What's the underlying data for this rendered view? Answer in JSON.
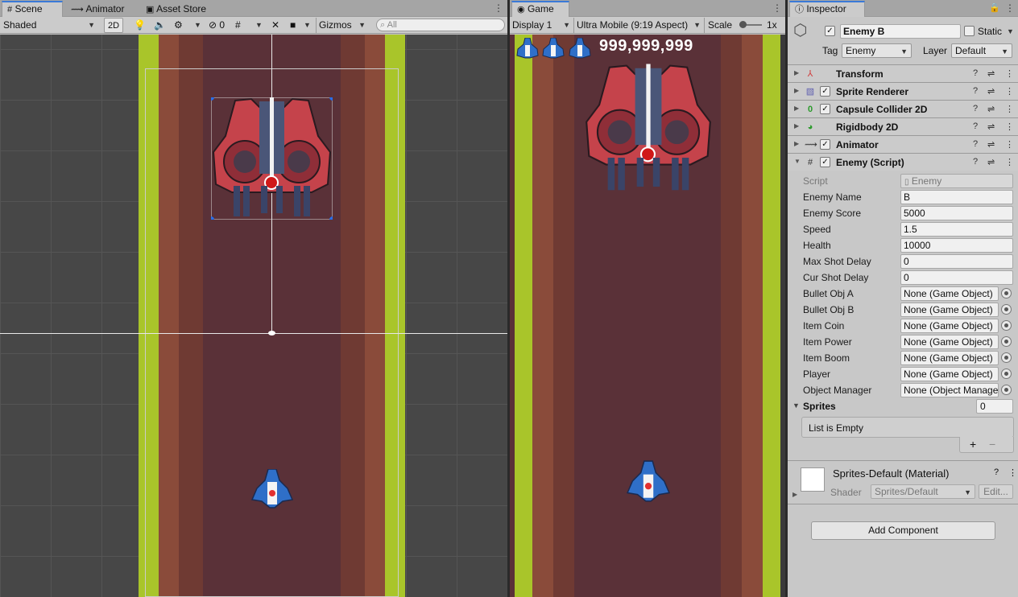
{
  "scene": {
    "tabs": [
      {
        "label": "Scene",
        "icon": "grid-icon"
      },
      {
        "label": "Animator",
        "icon": "animator-icon"
      },
      {
        "label": "Asset Store",
        "icon": "store-icon"
      }
    ],
    "shading_mode": "Shaded",
    "mode_2d_label": "2D",
    "hidden_count": "0",
    "gizmos_label": "Gizmos",
    "search_placeholder": "All"
  },
  "game": {
    "tab_label": "Game",
    "display": "Display 1",
    "aspect": "Ultra Mobile (9:19 Aspect)",
    "scale_label": "Scale",
    "scale_value": "1x",
    "score": "999,999,999",
    "lives": 3
  },
  "inspector": {
    "tab_label": "Inspector",
    "object_name": "Enemy B",
    "static_label": "Static",
    "tag_label": "Tag",
    "tag_value": "Enemy",
    "layer_label": "Layer",
    "layer_value": "Default",
    "components": [
      {
        "name": "Transform",
        "has_checkbox": false,
        "icon": "transform-icon",
        "color": "#d04040"
      },
      {
        "name": "Sprite Renderer",
        "has_checkbox": true,
        "icon": "sprite-renderer-icon",
        "color": "#6060b0"
      },
      {
        "name": "Capsule Collider 2D",
        "has_checkbox": true,
        "icon": "collider-icon",
        "color": "#2a9a2a"
      },
      {
        "name": "Rigidbody 2D",
        "has_checkbox": false,
        "icon": "rigidbody-icon",
        "color": "#2a9a2a"
      },
      {
        "name": "Animator",
        "has_checkbox": true,
        "icon": "animator-component-icon",
        "color": "#333333"
      },
      {
        "name": "Enemy (Script)",
        "has_checkbox": true,
        "icon": "script-icon",
        "color": "#333333"
      }
    ],
    "script_label": "Script",
    "script_value": "Enemy",
    "properties": [
      {
        "label": "Enemy Name",
        "value": "B",
        "type": "text"
      },
      {
        "label": "Enemy Score",
        "value": "5000",
        "type": "text"
      },
      {
        "label": "Speed",
        "value": "1.5",
        "type": "text"
      },
      {
        "label": "Health",
        "value": "10000",
        "type": "text"
      },
      {
        "label": "Max Shot Delay",
        "value": "0",
        "type": "text"
      },
      {
        "label": "Cur Shot Delay",
        "value": "0",
        "type": "text"
      },
      {
        "label": "Bullet Obj A",
        "value": "None (Game Object)",
        "type": "object"
      },
      {
        "label": "Bullet Obj B",
        "value": "None (Game Object)",
        "type": "object"
      },
      {
        "label": "Item Coin",
        "value": "None (Game Object)",
        "type": "object"
      },
      {
        "label": "Item Power",
        "value": "None (Game Object)",
        "type": "object"
      },
      {
        "label": "Item Boom",
        "value": "None (Game Object)",
        "type": "object"
      },
      {
        "label": "Player",
        "value": "None (Game Object)",
        "type": "object"
      },
      {
        "label": "Object Manager",
        "value": "None (Object Manage",
        "type": "object"
      }
    ],
    "sprites_label": "Sprites",
    "sprites_count": "0",
    "list_empty": "List is Empty",
    "material_name": "Sprites-Default (Material)",
    "shader_label": "Shader",
    "shader_value": "Sprites/Default",
    "edit_label": "Edit...",
    "add_component": "Add Component"
  }
}
